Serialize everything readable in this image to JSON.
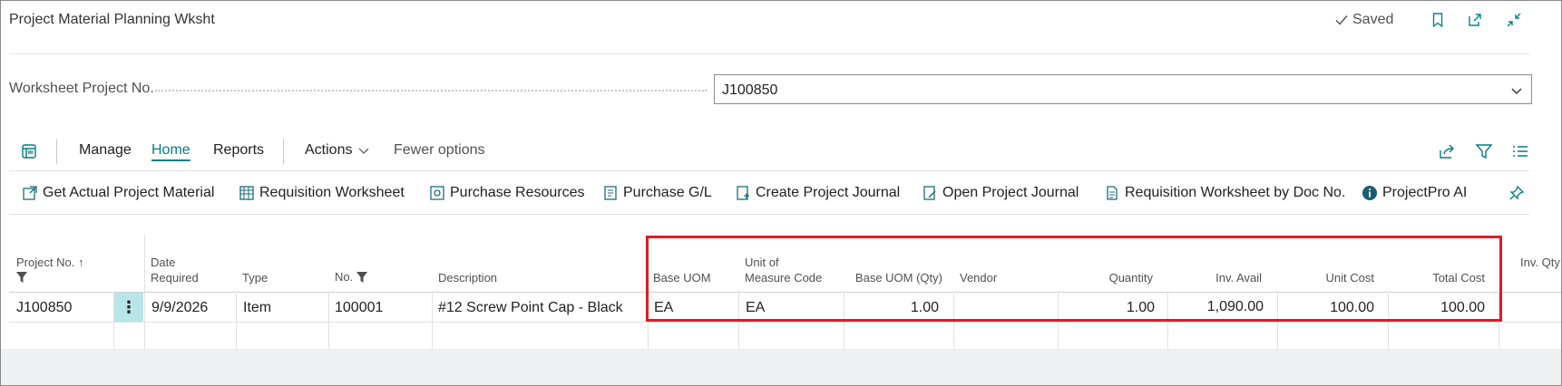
{
  "page": {
    "title": "Project Material Planning Wksht",
    "saved_label": "Saved"
  },
  "header_icons": [
    "bookmark-icon",
    "open-new-window-icon",
    "collapse-icon"
  ],
  "worksheet_field": {
    "label": "Worksheet Project No.",
    "value": "J100850"
  },
  "actionbar": {
    "manage": "Manage",
    "home": "Home",
    "reports": "Reports",
    "actions": "Actions",
    "fewer_options": "Fewer options"
  },
  "promoted_actions": {
    "get_actual": "Get Actual Project Material",
    "requisition": "Requisition Worksheet",
    "purchase_resources": "Purchase Resources",
    "purchase_gl": "Purchase G/L",
    "create_journal": "Create Project Journal",
    "open_journal": "Open Project Journal",
    "req_by_doc": "Requisition Worksheet by Doc No.",
    "projectpro_ai": "ProjectPro AI"
  },
  "grid": {
    "headers": {
      "project_no": "Project No.",
      "date_required_1": "Date",
      "date_required_2": "Required",
      "type": "Type",
      "no": "No.",
      "description": "Description",
      "base_uom": "Base UOM",
      "uom_code_1": "Unit of",
      "uom_code_2": "Measure Code",
      "base_uom_qty": "Base UOM (Qty)",
      "vendor": "Vendor",
      "quantity": "Quantity",
      "inv_avail": "Inv. Avail",
      "unit_cost": "Unit Cost",
      "total_cost": "Total Cost",
      "inv_qty": "Inv. Qty"
    },
    "rows": [
      {
        "project_no": "J100850",
        "date_required": "9/9/2026",
        "type": "Item",
        "no": "100001",
        "description": "#12 Screw Point Cap - Black",
        "base_uom": "EA",
        "uom_code": "EA",
        "base_uom_qty": "1.00",
        "vendor": "",
        "quantity": "1.00",
        "inv_avail": "1,090.00",
        "unit_cost": "100.00",
        "total_cost": "100.00"
      }
    ]
  },
  "colors": {
    "accent": "#007d85",
    "highlight_border": "#e01b24",
    "selected_cell": "#b7e5ea"
  }
}
